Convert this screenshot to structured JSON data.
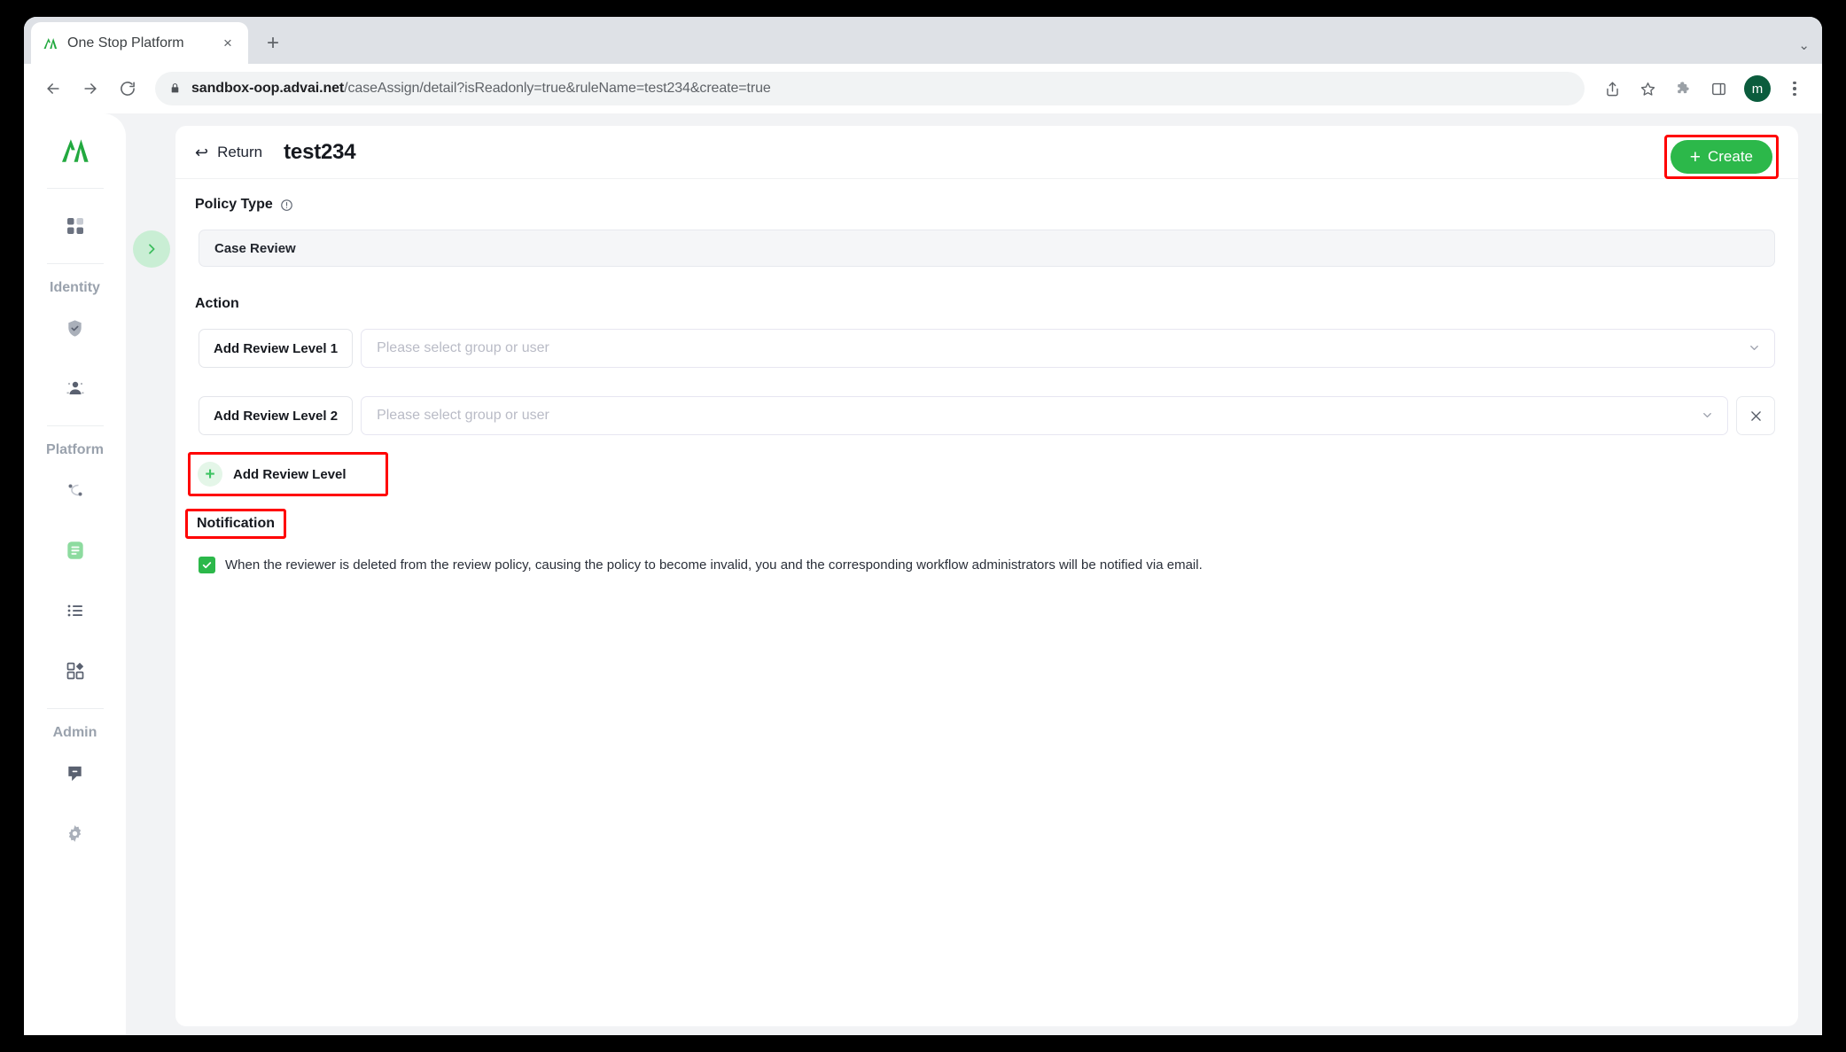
{
  "browser": {
    "tab": {
      "title": "One Stop Platform",
      "favicon": "advai-logo-icon",
      "close": "×"
    },
    "new_tab": "+",
    "tabstrip_menu": "⌄",
    "nav": {
      "back": "←",
      "forward": "→",
      "reload": "↻"
    },
    "omnibox": {
      "lock": "lock-icon",
      "url_domain": "sandbox-oop.advai.net",
      "url_path": "/caseAssign/detail?isReadonly=true&ruleName=test234&create=true",
      "url_full": "sandbox-oop.advai.net/caseAssign/detail?isReadonly=true&ruleName=test234&create=true"
    },
    "actions": {
      "share": "share-icon",
      "bookmark": "star-icon",
      "extensions": "puzzle-icon",
      "sidepanel": "side-panel-icon",
      "profile_initial": "m",
      "menu": "kebab-menu-icon"
    }
  },
  "sidebar": {
    "logo": "advai-logo-icon",
    "toggle": "›",
    "items": [
      {
        "name": "dashboard",
        "icon": "grid-squares-icon",
        "active": false
      },
      {
        "group_label": "Identity"
      },
      {
        "name": "security",
        "icon": "shield-check-icon",
        "active": false
      },
      {
        "name": "users",
        "icon": "users-group-icon",
        "active": false
      },
      {
        "group_label": "Platform"
      },
      {
        "name": "workflow",
        "icon": "nodes-link-icon",
        "active": false
      },
      {
        "name": "case-review",
        "icon": "document-lines-icon",
        "active": true
      },
      {
        "name": "lists",
        "icon": "list-bullets-icon",
        "active": false
      },
      {
        "name": "apps",
        "icon": "apps-grid-icon",
        "active": false
      },
      {
        "group_label": "Admin"
      },
      {
        "name": "messages",
        "icon": "chat-bubble-icon",
        "active": false
      },
      {
        "name": "settings",
        "icon": "gear-icon",
        "active": false
      }
    ],
    "groups": {
      "identity": "Identity",
      "platform": "Platform",
      "admin": "Admin"
    }
  },
  "header": {
    "return_label": "Return",
    "return_icon": "↩",
    "title": "test234",
    "create_label": "Create",
    "create_plus": "+"
  },
  "form": {
    "policy_type": {
      "heading": "Policy Type",
      "info_icon": "info-circle-icon",
      "value": "Case Review"
    },
    "action": {
      "heading": "Action",
      "levels": [
        {
          "badge": "Add Review Level 1",
          "placeholder": "Please select group or user",
          "value": "",
          "removable": false
        },
        {
          "badge": "Add Review Level 2",
          "placeholder": "Please select group or user",
          "value": "",
          "removable": true
        }
      ],
      "add_level_label": "Add Review Level",
      "add_level_plus": "+",
      "remove_icon": "✕",
      "chevron": "chevron-down-icon"
    },
    "notification": {
      "heading": "Notification",
      "checked": true,
      "check_glyph": "✓",
      "text": "When the reviewer is deleted from the review policy, causing the policy to become invalid, you and the corresponding workflow administrators will be notified via email."
    }
  },
  "colors": {
    "brand_green": "#2cb84a",
    "logo_green": "#22a93f",
    "highlight_red": "#ff0000",
    "toggle_bg": "#c9eed4",
    "page_bg": "#f2f3f5",
    "band_bg": "#f7f8fa"
  }
}
